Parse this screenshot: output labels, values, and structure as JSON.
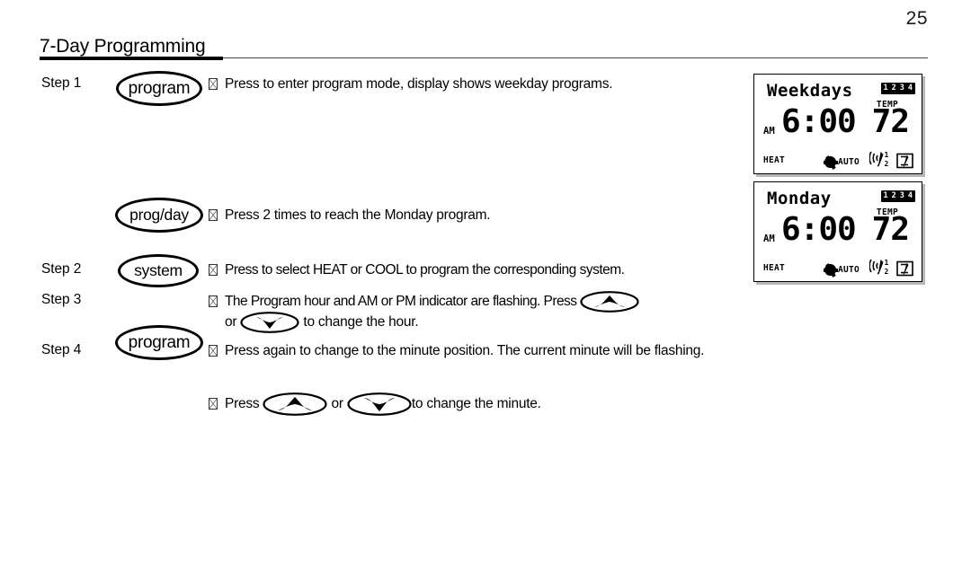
{
  "page": {
    "number": "25",
    "section_title": "7-Day Programming"
  },
  "steps": [
    {
      "label": "Step 1",
      "button": "program",
      "bullet_icon": "tofu-box-icon",
      "text": "Press to enter program mode, display shows weekday programs."
    },
    {
      "label": "",
      "button": "prog/day",
      "bullet_icon": "tofu-box-icon",
      "text": "Press 2 times to reach the Monday program."
    },
    {
      "label": "Step 2",
      "button": "system",
      "bullet_icon": "tofu-box-icon",
      "text": "Press to select HEAT or COOL to program the corresponding system."
    },
    {
      "label": "Step 3",
      "button": "",
      "bullet_icon": "tofu-box-icon",
      "text_before_up": "The Program hour and AM or PM indicator are flashing. Press",
      "text_or": "or",
      "text_after_down": "to change the hour.",
      "up_icon": "arrow-up-oval-icon",
      "down_icon": "arrow-down-oval-icon"
    },
    {
      "label": "Step 4",
      "button": "program",
      "bullet_icon": "tofu-box-icon",
      "text": "Press again to change to the minute position. The current minute will be flashing."
    },
    {
      "label": "",
      "button": "",
      "bullet_icon": "tofu-box-icon",
      "press_word": "Press",
      "text_or": "or",
      "text_after_down": "to change the minute.",
      "up_icon": "arrow-up-oval-icon",
      "down_icon": "arrow-down-oval-icon"
    }
  ],
  "displays": [
    {
      "name": "weekdays-display",
      "day": "Weekdays",
      "day_numbers": [
        "1",
        "2",
        "3",
        "4"
      ],
      "temp_label": "TEMP",
      "ampm": "AM",
      "time": "6:00",
      "temp_value": "72",
      "mode": "HEAT",
      "fan_label": "AUTO",
      "fan_icon": "fan-blob-icon",
      "sensor_icons": [
        "antenna-signal-icon",
        "remote-sensor-icon"
      ],
      "sensor_numbers": [
        "1",
        "2"
      ]
    },
    {
      "name": "monday-display",
      "day": "Monday",
      "day_numbers": [
        "1",
        "2",
        "3",
        "4"
      ],
      "temp_label": "TEMP",
      "ampm": "AM",
      "time": "6:00",
      "temp_value": "72",
      "mode": "HEAT",
      "fan_label": "AUTO",
      "fan_icon": "fan-blob-icon",
      "sensor_icons": [
        "antenna-signal-icon",
        "remote-sensor-icon"
      ],
      "sensor_numbers": [
        "1",
        "2"
      ]
    }
  ],
  "colors": {
    "ink": "#000000",
    "paper": "#ffffff",
    "rule": "#444444",
    "shadow": "#aaaaaa"
  }
}
